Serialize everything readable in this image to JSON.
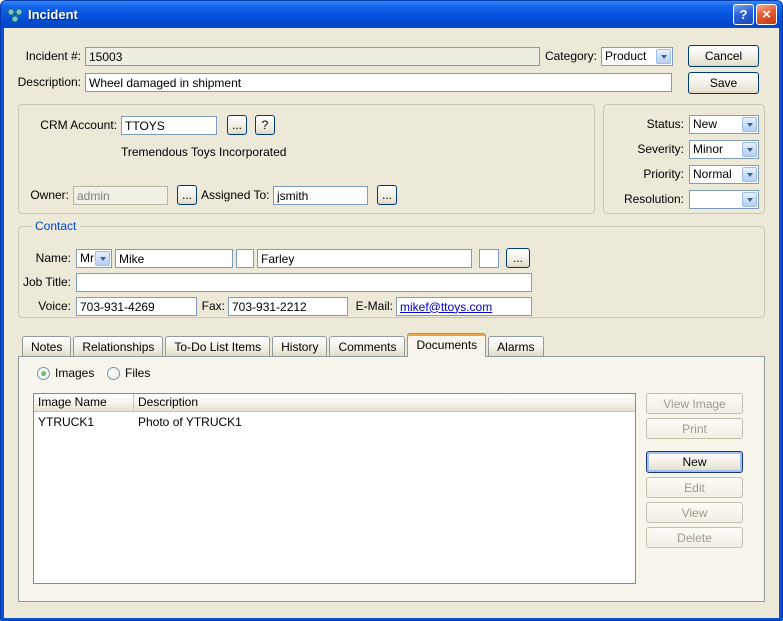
{
  "window": {
    "title": "Incident"
  },
  "glyphs": {
    "help": "?",
    "close": "×",
    "ellipsis": "..."
  },
  "header": {
    "incident_label": "Incident #:",
    "incident_value": "15003",
    "category_label": "Category:",
    "category_value": "Product",
    "description_label": "Description:",
    "description_value": "Wheel damaged in shipment",
    "cancel_button": "Cancel",
    "save_button": "Save"
  },
  "account": {
    "crm_label": "CRM Account:",
    "crm_value": "TTOYS",
    "account_name": "Tremendous Toys Incorporated",
    "owner_label": "Owner:",
    "owner_value": "admin",
    "assigned_label": "Assigned To:",
    "assigned_value": "jsmith"
  },
  "status_panel": {
    "status_label": "Status:",
    "status_value": "New",
    "severity_label": "Severity:",
    "severity_value": "Minor",
    "priority_label": "Priority:",
    "priority_value": "Normal",
    "resolution_label": "Resolution:",
    "resolution_value": ""
  },
  "contact": {
    "group_label": "Contact",
    "name_label": "Name:",
    "salutation": "Mr",
    "first_name": "Mike",
    "middle_initial": "",
    "last_name": "Farley",
    "suffix": "",
    "job_title_label": "Job Title:",
    "job_title_value": "",
    "voice_label": "Voice:",
    "voice_value": "703-931-4269",
    "fax_label": "Fax:",
    "fax_value": "703-931-2212",
    "email_label": "E-Mail:",
    "email_value": "mikef@ttoys.com"
  },
  "tabs": [
    {
      "label": "Notes",
      "active": false
    },
    {
      "label": "Relationships",
      "active": false
    },
    {
      "label": "To-Do List Items",
      "active": false
    },
    {
      "label": "History",
      "active": false
    },
    {
      "label": "Comments",
      "active": false
    },
    {
      "label": "Documents",
      "active": true
    },
    {
      "label": "Alarms",
      "active": false
    }
  ],
  "documents": {
    "radio_images": "Images",
    "radio_files": "Files",
    "selected_radio": "Images",
    "table": {
      "columns": [
        "Image Name",
        "Description"
      ],
      "rows": [
        [
          "YTRUCK1",
          "Photo of YTRUCK1"
        ]
      ]
    },
    "buttons": [
      {
        "label": "View Image",
        "enabled": false
      },
      {
        "label": "Print",
        "enabled": false
      },
      {
        "label": "New",
        "enabled": true,
        "default": true
      },
      {
        "label": "Edit",
        "enabled": false
      },
      {
        "label": "View",
        "enabled": false
      },
      {
        "label": "Delete",
        "enabled": false
      }
    ]
  },
  "colors": {
    "titlebar_blue": "#0655DE",
    "window_bg": "#ECE9D8",
    "field_border": "#7F9DB9",
    "link_blue": "#0000CC",
    "groupbox_caption_blue": "#0046D5",
    "active_tab_accent": "#F3A338"
  }
}
